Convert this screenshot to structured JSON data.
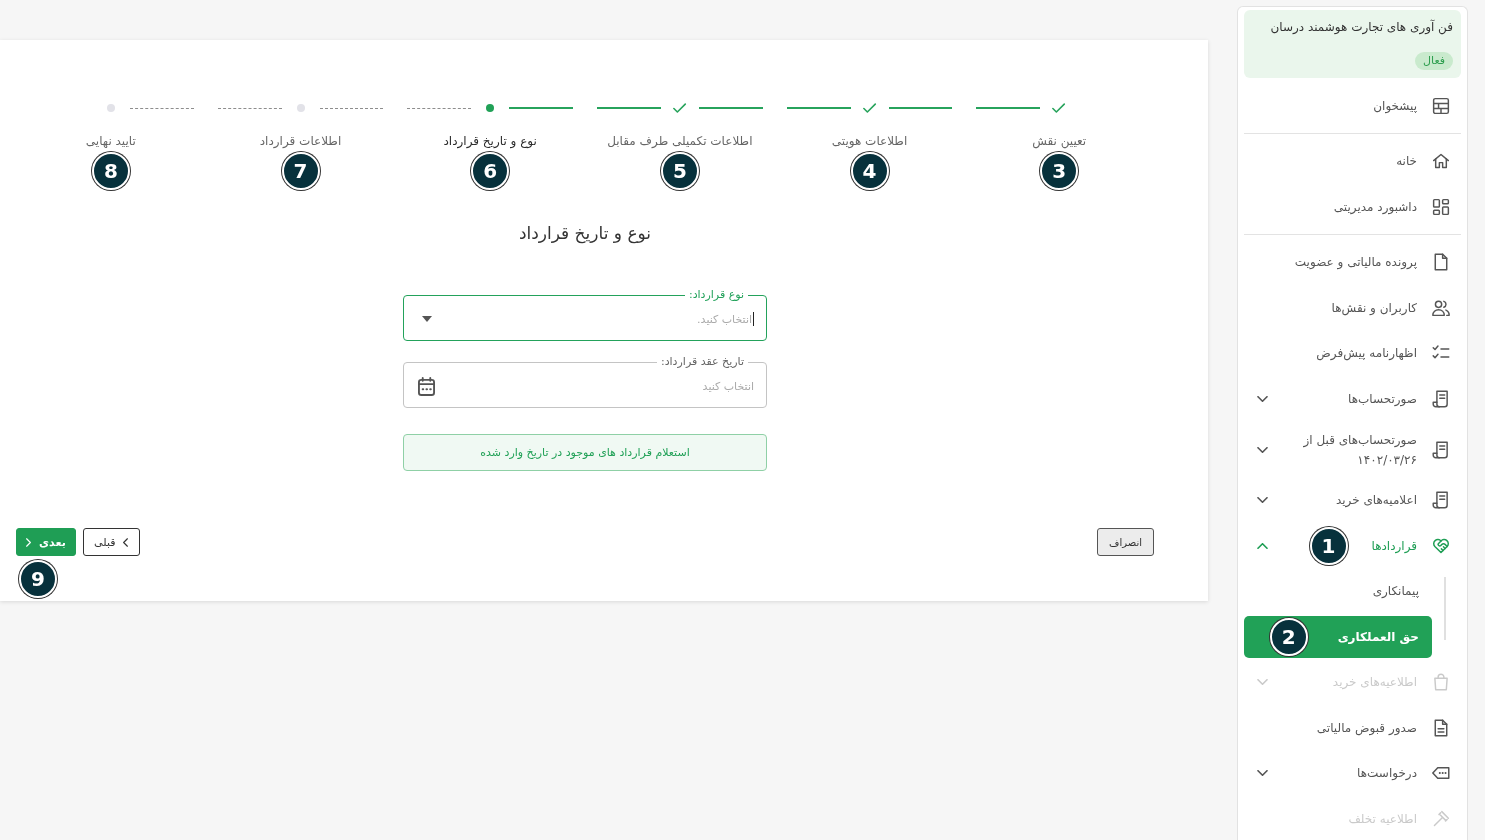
{
  "sidebar": {
    "company": {
      "name": "فن آوری های تجارت هوشمند درسان",
      "status": "فعال"
    },
    "sections": [
      {
        "items": [
          {
            "kind": "link",
            "label": "پیشخوان",
            "selected": false,
            "disabled": false
          }
        ]
      },
      {
        "items": [
          {
            "kind": "link",
            "label": "خانه",
            "selected": false,
            "disabled": false
          },
          {
            "kind": "link",
            "label": "داشبورد مدیریتی",
            "selected": false,
            "disabled": false
          }
        ]
      },
      {
        "items": [
          {
            "kind": "link",
            "label": "پرونده مالیاتی و عضویت",
            "selected": false,
            "disabled": false
          },
          {
            "kind": "link",
            "label": "کاربران و نقش‌ها",
            "selected": false,
            "disabled": false
          },
          {
            "kind": "link",
            "label": "اظهارنامه پیش‌فرض",
            "selected": false,
            "disabled": false
          },
          {
            "kind": "group",
            "label": "صورتحساب‌ها",
            "selected": false,
            "disabled": false,
            "expanded": false
          },
          {
            "kind": "group",
            "label": "صورتحساب‌های قبل از ۱۴۰۲/۰۳/۲۶",
            "selected": false,
            "disabled": false,
            "expanded": false
          },
          {
            "kind": "group",
            "label": "اعلامیه‌های خرید",
            "selected": false,
            "disabled": false,
            "expanded": false
          },
          {
            "kind": "group",
            "label": "قراردادها",
            "selected": false,
            "disabled": false,
            "expanded": true,
            "marker": "1",
            "children": [
              {
                "label": "پیمانکاری",
                "selected": false
              },
              {
                "label": "حق العملکاری",
                "selected": true,
                "marker": "2"
              }
            ]
          },
          {
            "kind": "group",
            "label": "اطلاعیه‌های خرید",
            "selected": false,
            "disabled": true,
            "expanded": false
          },
          {
            "kind": "link",
            "label": "صدور قبوض مالیاتی",
            "selected": false,
            "disabled": false
          },
          {
            "kind": "group",
            "label": "درخواست‌ها",
            "selected": false,
            "disabled": false,
            "expanded": false
          },
          {
            "kind": "link",
            "label": "اطلاعیه تخلف",
            "selected": false,
            "disabled": true
          }
        ]
      }
    ]
  },
  "stepper": {
    "steps": [
      {
        "label": "تعیین نقش",
        "completed": true,
        "selected": false,
        "marker": "3"
      },
      {
        "label": "اطلاعات هویتی",
        "completed": true,
        "selected": false,
        "marker": "4"
      },
      {
        "label": "اطلاعات تکمیلی طرف مقابل",
        "completed": true,
        "selected": false,
        "marker": "5"
      },
      {
        "label": "نوع و تاریخ قرارداد",
        "completed": false,
        "selected": true,
        "marker": "6"
      },
      {
        "label": "اطلاعات قرارداد",
        "completed": false,
        "selected": false,
        "marker": "7"
      },
      {
        "label": "تایید نهایی",
        "completed": false,
        "selected": false,
        "marker": "8"
      }
    ]
  },
  "form": {
    "title": "نوع و تاریخ قرارداد",
    "fields": [
      {
        "kind": "select",
        "label": "نوع قرارداد:",
        "placeholder": "انتخاب کنید.",
        "focused": true
      },
      {
        "kind": "date",
        "label": "تاریخ عقد قرارداد:",
        "placeholder": "انتخاب کنید",
        "focused": false
      }
    ],
    "inquiry_button": "استعلام قرارداد های موجود در تاریخ وارد شده"
  },
  "actions": [
    {
      "kind": "cancel",
      "label": "انصراف"
    },
    {
      "kind": "previous",
      "label": "قبلی"
    },
    {
      "kind": "next",
      "label": "بعدی",
      "marker": "9"
    }
  ]
}
